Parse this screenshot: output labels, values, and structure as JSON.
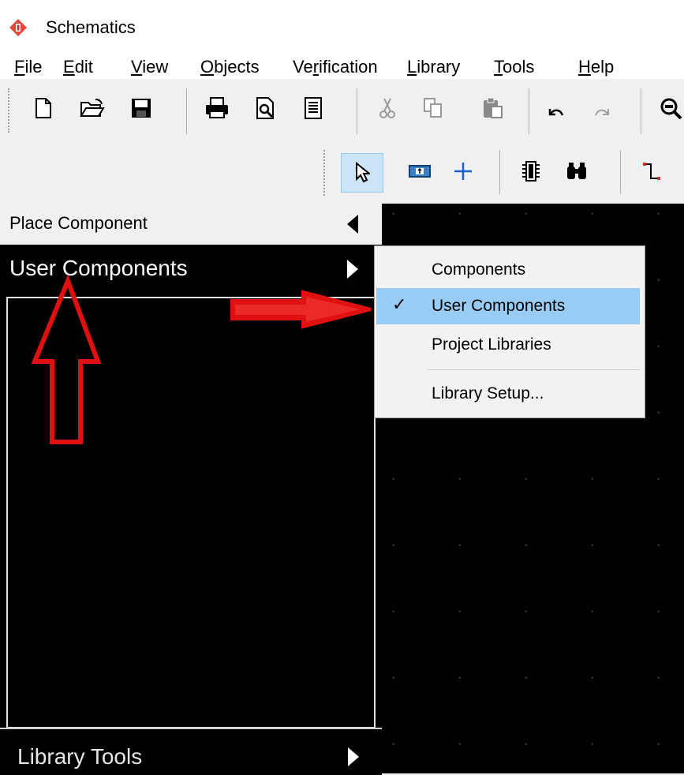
{
  "window": {
    "title": "Schematics",
    "icon": "app-logo-icon"
  },
  "menu": [
    {
      "accel": "F",
      "rest": "ile"
    },
    {
      "accel": "E",
      "rest": "dit"
    },
    {
      "accel": "V",
      "rest": "iew"
    },
    {
      "accel": "O",
      "rest": "bjects"
    },
    {
      "pre": "Ve",
      "accel": "r",
      "rest": "ification"
    },
    {
      "accel": "L",
      "rest": "ibrary"
    },
    {
      "accel": "T",
      "rest": "ools"
    },
    {
      "accel": "H",
      "rest": "elp"
    }
  ],
  "toolbar1": [
    "new-file-icon",
    "open-folder-icon",
    "save-icon",
    "print-icon",
    "print-preview-icon",
    "report-icon",
    "cut-icon",
    "copy-icon",
    "paste-icon",
    "undo-icon",
    "redo-icon",
    "zoom-icon"
  ],
  "toolbar2": [
    "select-arrow-icon",
    "place-part-icon",
    "add-junction-icon",
    "component-icon",
    "find-binoculars-icon",
    "wire-icon"
  ],
  "panel": {
    "place_component": "Place Component",
    "user_components": "User Components",
    "library_tools": "Library Tools"
  },
  "popup": {
    "items": [
      "Components",
      "User Components",
      "Project Libraries",
      "Library Setup..."
    ],
    "checked": "User Components",
    "checkmark": "✓"
  },
  "colors": {
    "highlight": "#99ccf5",
    "annotation": "#e01010",
    "canvas": "#000000"
  }
}
